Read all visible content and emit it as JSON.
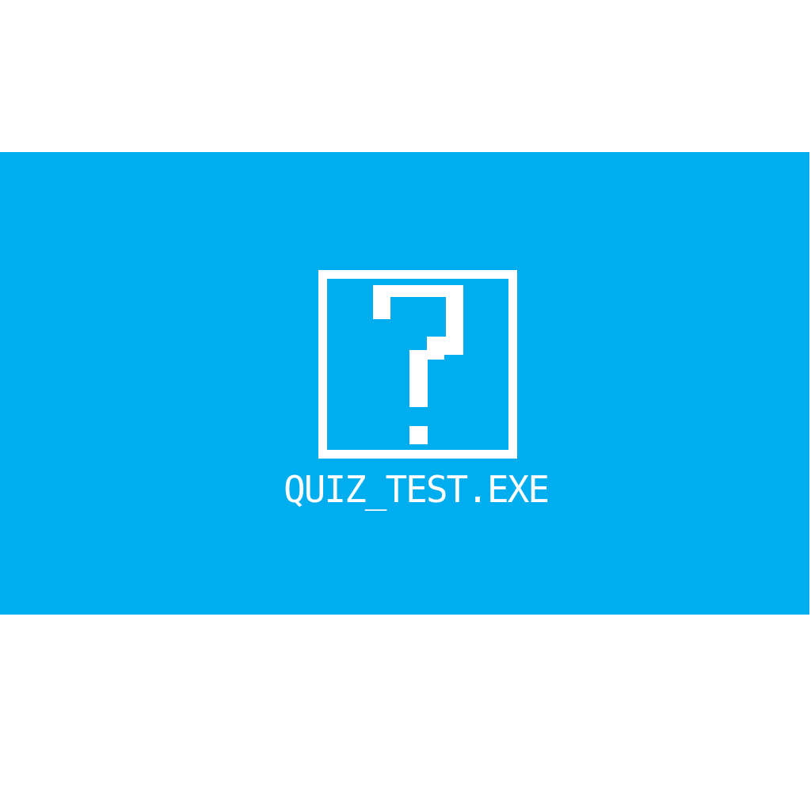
{
  "colors": {
    "background": "#ffffff",
    "banner": "#00adee",
    "foreground": "#ffffff"
  },
  "desktop_icon": {
    "icon": "question-mark-window-icon",
    "label": "QUIZ_TEST.EXE"
  }
}
